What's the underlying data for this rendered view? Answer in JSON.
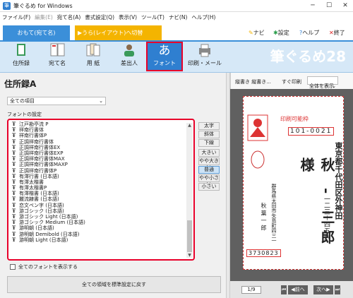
{
  "window": {
    "title": "筆ぐるめ for Windows"
  },
  "menu": [
    {
      "label": "ファイル(F)",
      "disabled": false
    },
    {
      "label": "編集(E)",
      "disabled": true
    },
    {
      "label": "宛て名(A)",
      "disabled": false
    },
    {
      "label": "書式設定(Q)",
      "disabled": false
    },
    {
      "label": "表示(V)",
      "disabled": false
    },
    {
      "label": "ツール(T)",
      "disabled": false
    },
    {
      "label": "ナビ(N)",
      "disabled": false
    },
    {
      "label": "ヘルプ(H)",
      "disabled": false
    }
  ],
  "modes": {
    "front": "おもて(宛て名)",
    "switch": "▶うら(レイアウト)へ切替"
  },
  "header_links": {
    "navi": "ナビ",
    "settings": "設定",
    "help": "ヘルプ",
    "exit": "終了"
  },
  "ribbon": {
    "buttons": [
      "住所録",
      "宛て名",
      "用 紙",
      "差出人",
      "フォント",
      "印刷・メール"
    ],
    "active": "フォント",
    "font_glyph": "あ",
    "logo": "筆ぐるめ28"
  },
  "panel": {
    "title": "住所録A",
    "category_selected": "全ての項目",
    "font_settings_label": "フォントの設定",
    "fonts": [
      "江戸勘亭流 P",
      "祥南行書体",
      "祥南行書体P",
      "正調祥南行書体",
      "正調祥南行書体EX",
      "正調祥南行書体EXP",
      "正調祥南行書体MAX",
      "正調祥南行書体MAXP",
      "正調祥南行書体P",
      "有澤行書 (日本語)",
      "有澤太楷書",
      "有澤太楷書P",
      "有澤楷書 (日本語)",
      "麗流隷書 (日本語)",
      "恋文ペン字 (日本語)",
      "游ゴシック (日本語)",
      "游ゴシック Light (日本語)",
      "游ゴシック Medium (日本語)",
      "游明朝 (日本語)",
      "游明朝 Demibold (日本語)",
      "游明朝 Light (日本語)"
    ],
    "style_buttons": [
      "太字",
      "斜体",
      "下線"
    ],
    "size_buttons": [
      "大きい",
      "やや大きい",
      "普通",
      "やや小さい",
      "小さい"
    ],
    "size_selected": "普通",
    "show_all_fonts": "全てのフォントを表示する",
    "reset_button": "全ての領域を標準設定に戻す"
  },
  "preview": {
    "orientation": "縦書き 縦書き...",
    "quick_print": "すぐ印刷",
    "view_select": "全体を表示",
    "printable_label": "印刷可能枠",
    "postal_code": "101-0021",
    "address_lines": [
      "東京都千代田区外神田",
      "一二三－四五六"
    ],
    "recipient_name": "秋 - 三郎 様",
    "sender_address": "群馬県太田市矢島町四三一",
    "sender_name": "秋 葉 一 郎",
    "sender_postal": "3730823",
    "page": "1/9",
    "prev": "前へ",
    "next": "次へ"
  },
  "colors": {
    "accent": "#2f7fd0",
    "highlight": "#e8002a",
    "switch": "#f4b400"
  }
}
